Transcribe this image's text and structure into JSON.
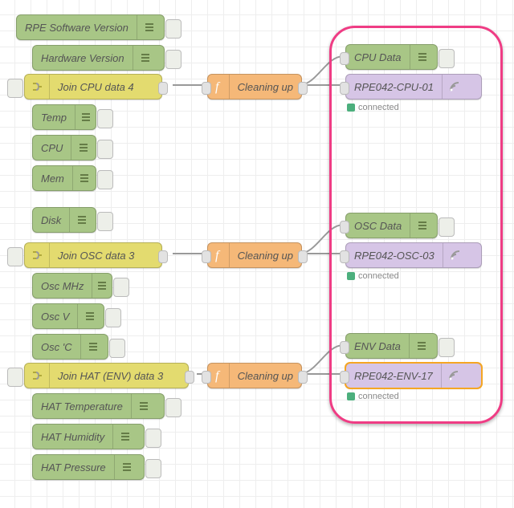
{
  "left": [
    "RPE Software Version",
    "Hardware Version",
    "Temp",
    "CPU",
    "Mem",
    "Disk",
    "Osc MHz",
    "Osc V",
    "Osc 'C",
    "HAT Temperature",
    "HAT Humidity",
    "HAT Pressure"
  ],
  "joins": [
    "Join CPU data 4",
    "Join OSC data 3",
    "Join HAT (ENV) data 3"
  ],
  "functions": [
    "Cleaning up",
    "Cleaning up",
    "Cleaning up"
  ],
  "outputs": [
    {
      "debug": "CPU Data",
      "topic": "RPE042-CPU-01",
      "status": "connected"
    },
    {
      "debug": "OSC Data",
      "topic": "RPE042-OSC-03",
      "status": "connected"
    },
    {
      "debug": "ENV Data",
      "topic": "RPE042-ENV-17",
      "status": "connected",
      "selected": true
    }
  ],
  "colors": {
    "green": "#a8c686",
    "yellow": "#e3db6f",
    "orange": "#f5b878",
    "purple": "#d6c5e6",
    "highlight": "#ef3c84",
    "status_ok": "#4caf7d"
  }
}
